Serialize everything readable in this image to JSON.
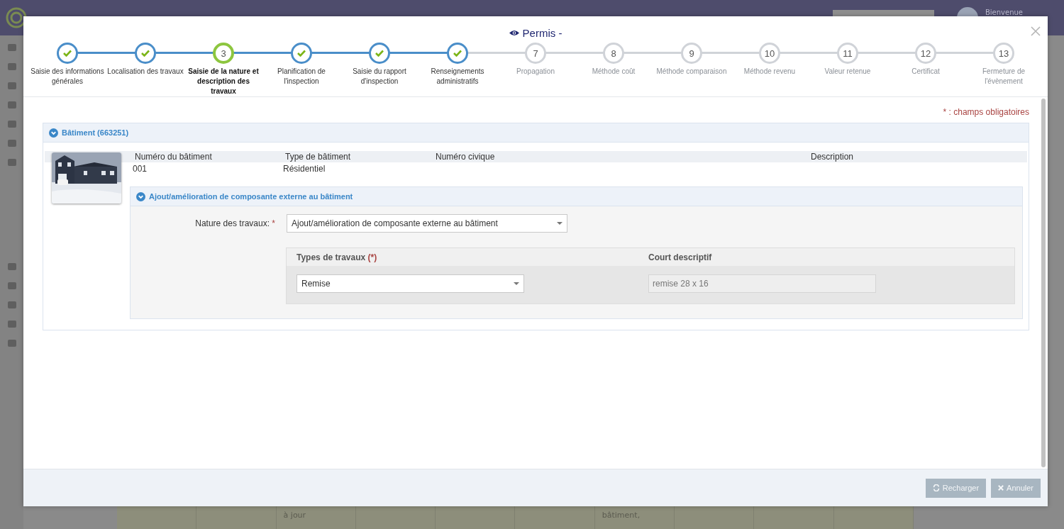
{
  "background": {
    "user_greeting": "Bienvenue",
    "table_cells": [
      "",
      "",
      "à jour",
      "",
      "",
      "",
      "bâtiment,",
      "",
      "",
      ""
    ]
  },
  "modal": {
    "title": "Permis -",
    "steps": [
      {
        "label": "Saisie des informations générales",
        "completed": true,
        "selected": false
      },
      {
        "label": "Localisation des travaux",
        "completed": true,
        "selected": false
      },
      {
        "label": "Saisie de la nature et description des travaux",
        "completed": false,
        "selected": true,
        "number": "3"
      },
      {
        "label": "Planification de l'inspection",
        "completed": true,
        "selected": false
      },
      {
        "label": "Saisie du rapport d'inspection",
        "completed": true,
        "selected": false
      },
      {
        "label": "Renseignements administratifs",
        "completed": true,
        "selected": false
      },
      {
        "label": "Propagation",
        "completed": false,
        "selected": false,
        "number": "7"
      },
      {
        "label": "Méthode coût",
        "completed": false,
        "selected": false,
        "number": "8"
      },
      {
        "label": "Méthode comparaison",
        "completed": false,
        "selected": false,
        "number": "9"
      },
      {
        "label": "Méthode revenu",
        "completed": false,
        "selected": false,
        "number": "10"
      },
      {
        "label": "Valeur retenue",
        "completed": false,
        "selected": false,
        "number": "11"
      },
      {
        "label": "Certificat",
        "completed": false,
        "selected": false,
        "number": "12"
      },
      {
        "label": "Fermeture de l'évènement",
        "completed": false,
        "selected": false,
        "number": "13"
      }
    ],
    "required_note": "* : champs obligatoires",
    "building_panel": {
      "title": "Bâtiment (663251)",
      "expanded": true,
      "columns": [
        "Numéro du bâtiment",
        "Type de bâtiment",
        "Numéro civique",
        "Description"
      ],
      "values": [
        "001",
        "Résidentiel"
      ],
      "work_panel": {
        "title": "Ajout/amélioration de composante externe au bâtiment",
        "expanded": true,
        "nature_label": "Nature des travaux:",
        "nature_mark": "*",
        "nature_value": "Ajout/amélioration de composante externe au bâtiment",
        "types_columns": [
          {
            "label": "Types de travaux",
            "mark": "(*)"
          },
          {
            "label": "Court descriptif"
          }
        ],
        "types_rows": [
          {
            "type": "Remise",
            "description": "remise 28 x 16"
          }
        ]
      }
    },
    "buttons": [
      {
        "label": "Recharger",
        "kind": "reload"
      },
      {
        "label": "Annuler",
        "kind": "cancel"
      }
    ]
  }
}
